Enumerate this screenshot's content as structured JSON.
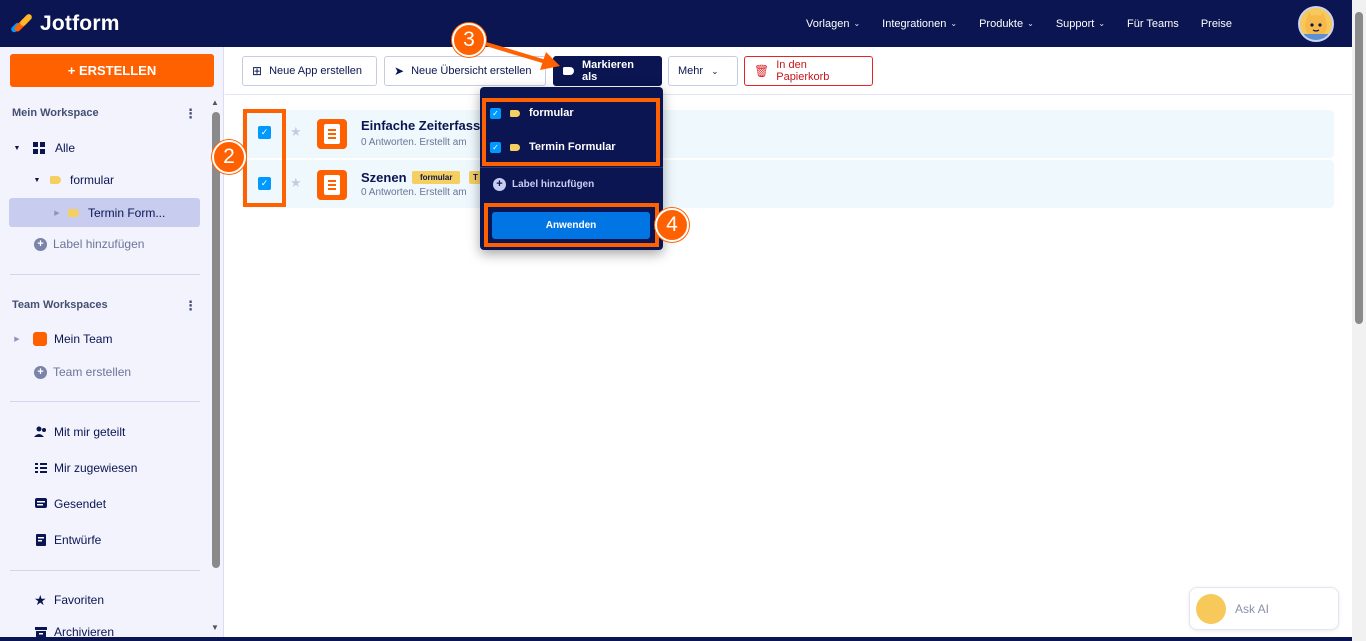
{
  "brand": {
    "name": "Jotform",
    "colors": {
      "navy": "#0a1551",
      "orange": "#ff6100",
      "blue": "#0099ff",
      "yellow": "#f5cf5f",
      "apply": "#0075e3"
    }
  },
  "nav": {
    "items": [
      "Vorlagen",
      "Integrationen",
      "Produkte",
      "Support",
      "Für Teams",
      "Preise"
    ]
  },
  "sidebar": {
    "create_label": "+ ERSTELLEN",
    "my_workspace": {
      "heading": "Mein Workspace",
      "all_label": "Alle",
      "folder_label": "formular",
      "subfolder_label": "Termin Form...",
      "add_label": "Label hinzufügen"
    },
    "team_workspaces": {
      "heading": "Team Workspaces",
      "team_label": "Mein Team",
      "create_team_label": "Team erstellen"
    },
    "links": [
      "Mit mir geteilt",
      "Mir zugewiesen",
      "Gesendet",
      "Entwürfe"
    ],
    "bottom_links": [
      "Favoriten",
      "Archivieren"
    ]
  },
  "toolbar": {
    "new_app": "Neue App erstellen",
    "new_overview": "Neue Übersicht erstellen",
    "mark_as": "Markieren als",
    "more": "Mehr",
    "trash": "In den Papierkorb"
  },
  "forms": [
    {
      "title": "Einfache Zeiterfass",
      "subtitle": "0 Antworten. Erstellt am",
      "checked": true,
      "tags": []
    },
    {
      "title": "Szenen",
      "subtitle": "0 Antworten. Erstellt am",
      "checked": true,
      "tags": [
        "formular",
        "T"
      ]
    }
  ],
  "dropdown": {
    "labels": [
      {
        "name": "formular",
        "checked": true
      },
      {
        "name": "Termin Formular",
        "checked": true
      }
    ],
    "add_label": "Label hinzufügen",
    "apply_label": "Anwenden"
  },
  "annotations": [
    "2",
    "3",
    "4"
  ],
  "ask_ai": {
    "label": "Ask AI"
  }
}
